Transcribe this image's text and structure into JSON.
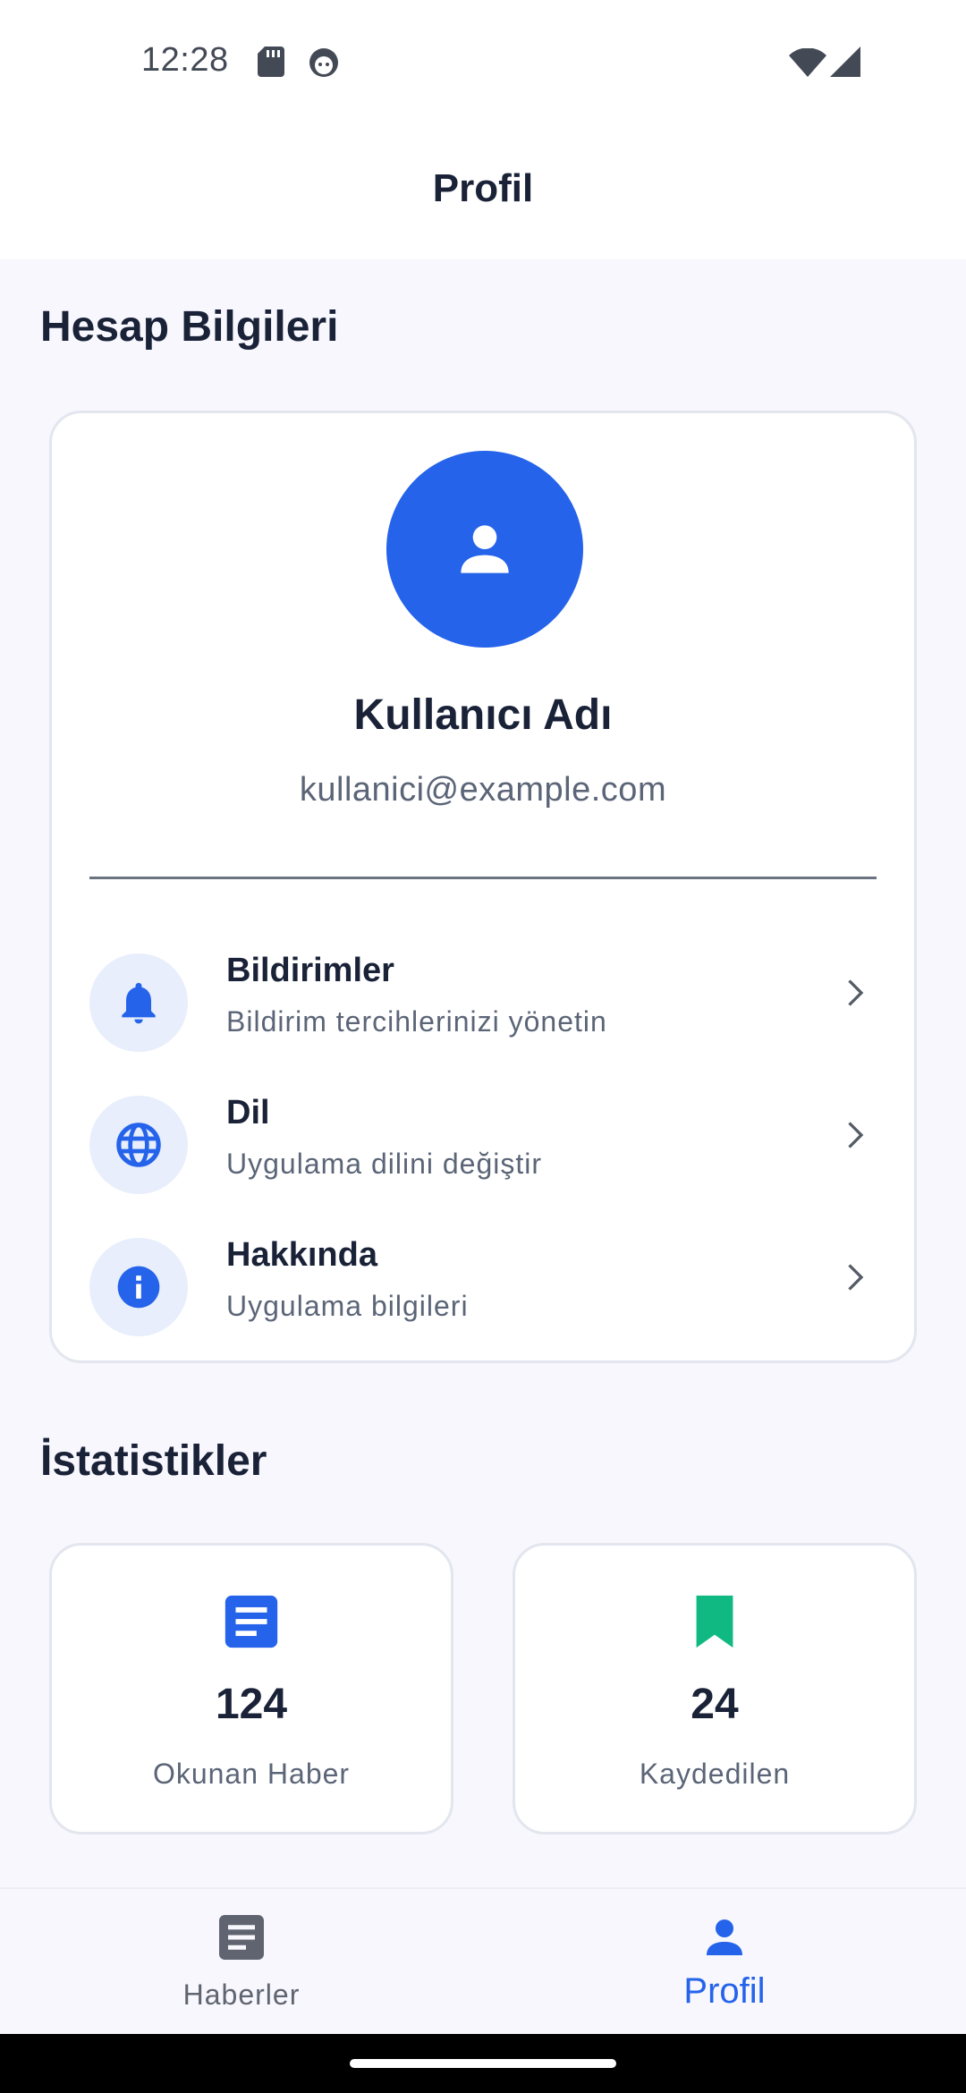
{
  "status_bar": {
    "time": "12:28"
  },
  "header": {
    "title": "Profil"
  },
  "account": {
    "section_title": "Hesap Bilgileri",
    "user_name": "Kullanıcı Adı",
    "user_email": "kullanici@example.com"
  },
  "menu": {
    "items": [
      {
        "title": "Bildirimler",
        "subtitle": "Bildirim tercihlerinizi yönetin",
        "icon": "bell-icon"
      },
      {
        "title": "Dil",
        "subtitle": "Uygulama dilini değiştir",
        "icon": "globe-icon"
      },
      {
        "title": "Hakkında",
        "subtitle": "Uygulama bilgileri",
        "icon": "info-icon"
      }
    ]
  },
  "stats": {
    "section_title": "İstatistikler",
    "items": [
      {
        "value": "124",
        "label": "Okunan Haber",
        "icon": "article-icon",
        "color": "#2563eb"
      },
      {
        "value": "24",
        "label": "Kaydedilen",
        "icon": "bookmark-icon",
        "color": "#10b981"
      }
    ]
  },
  "bottom_nav": {
    "items": [
      {
        "label": "Haberler",
        "icon": "article-icon",
        "active": false
      },
      {
        "label": "Profil",
        "icon": "person-icon",
        "active": true
      }
    ]
  },
  "colors": {
    "accent": "#2563eb",
    "success": "#10b981",
    "text_primary": "#1a2238",
    "text_secondary": "#5b6577",
    "background": "#f7f7fd"
  }
}
